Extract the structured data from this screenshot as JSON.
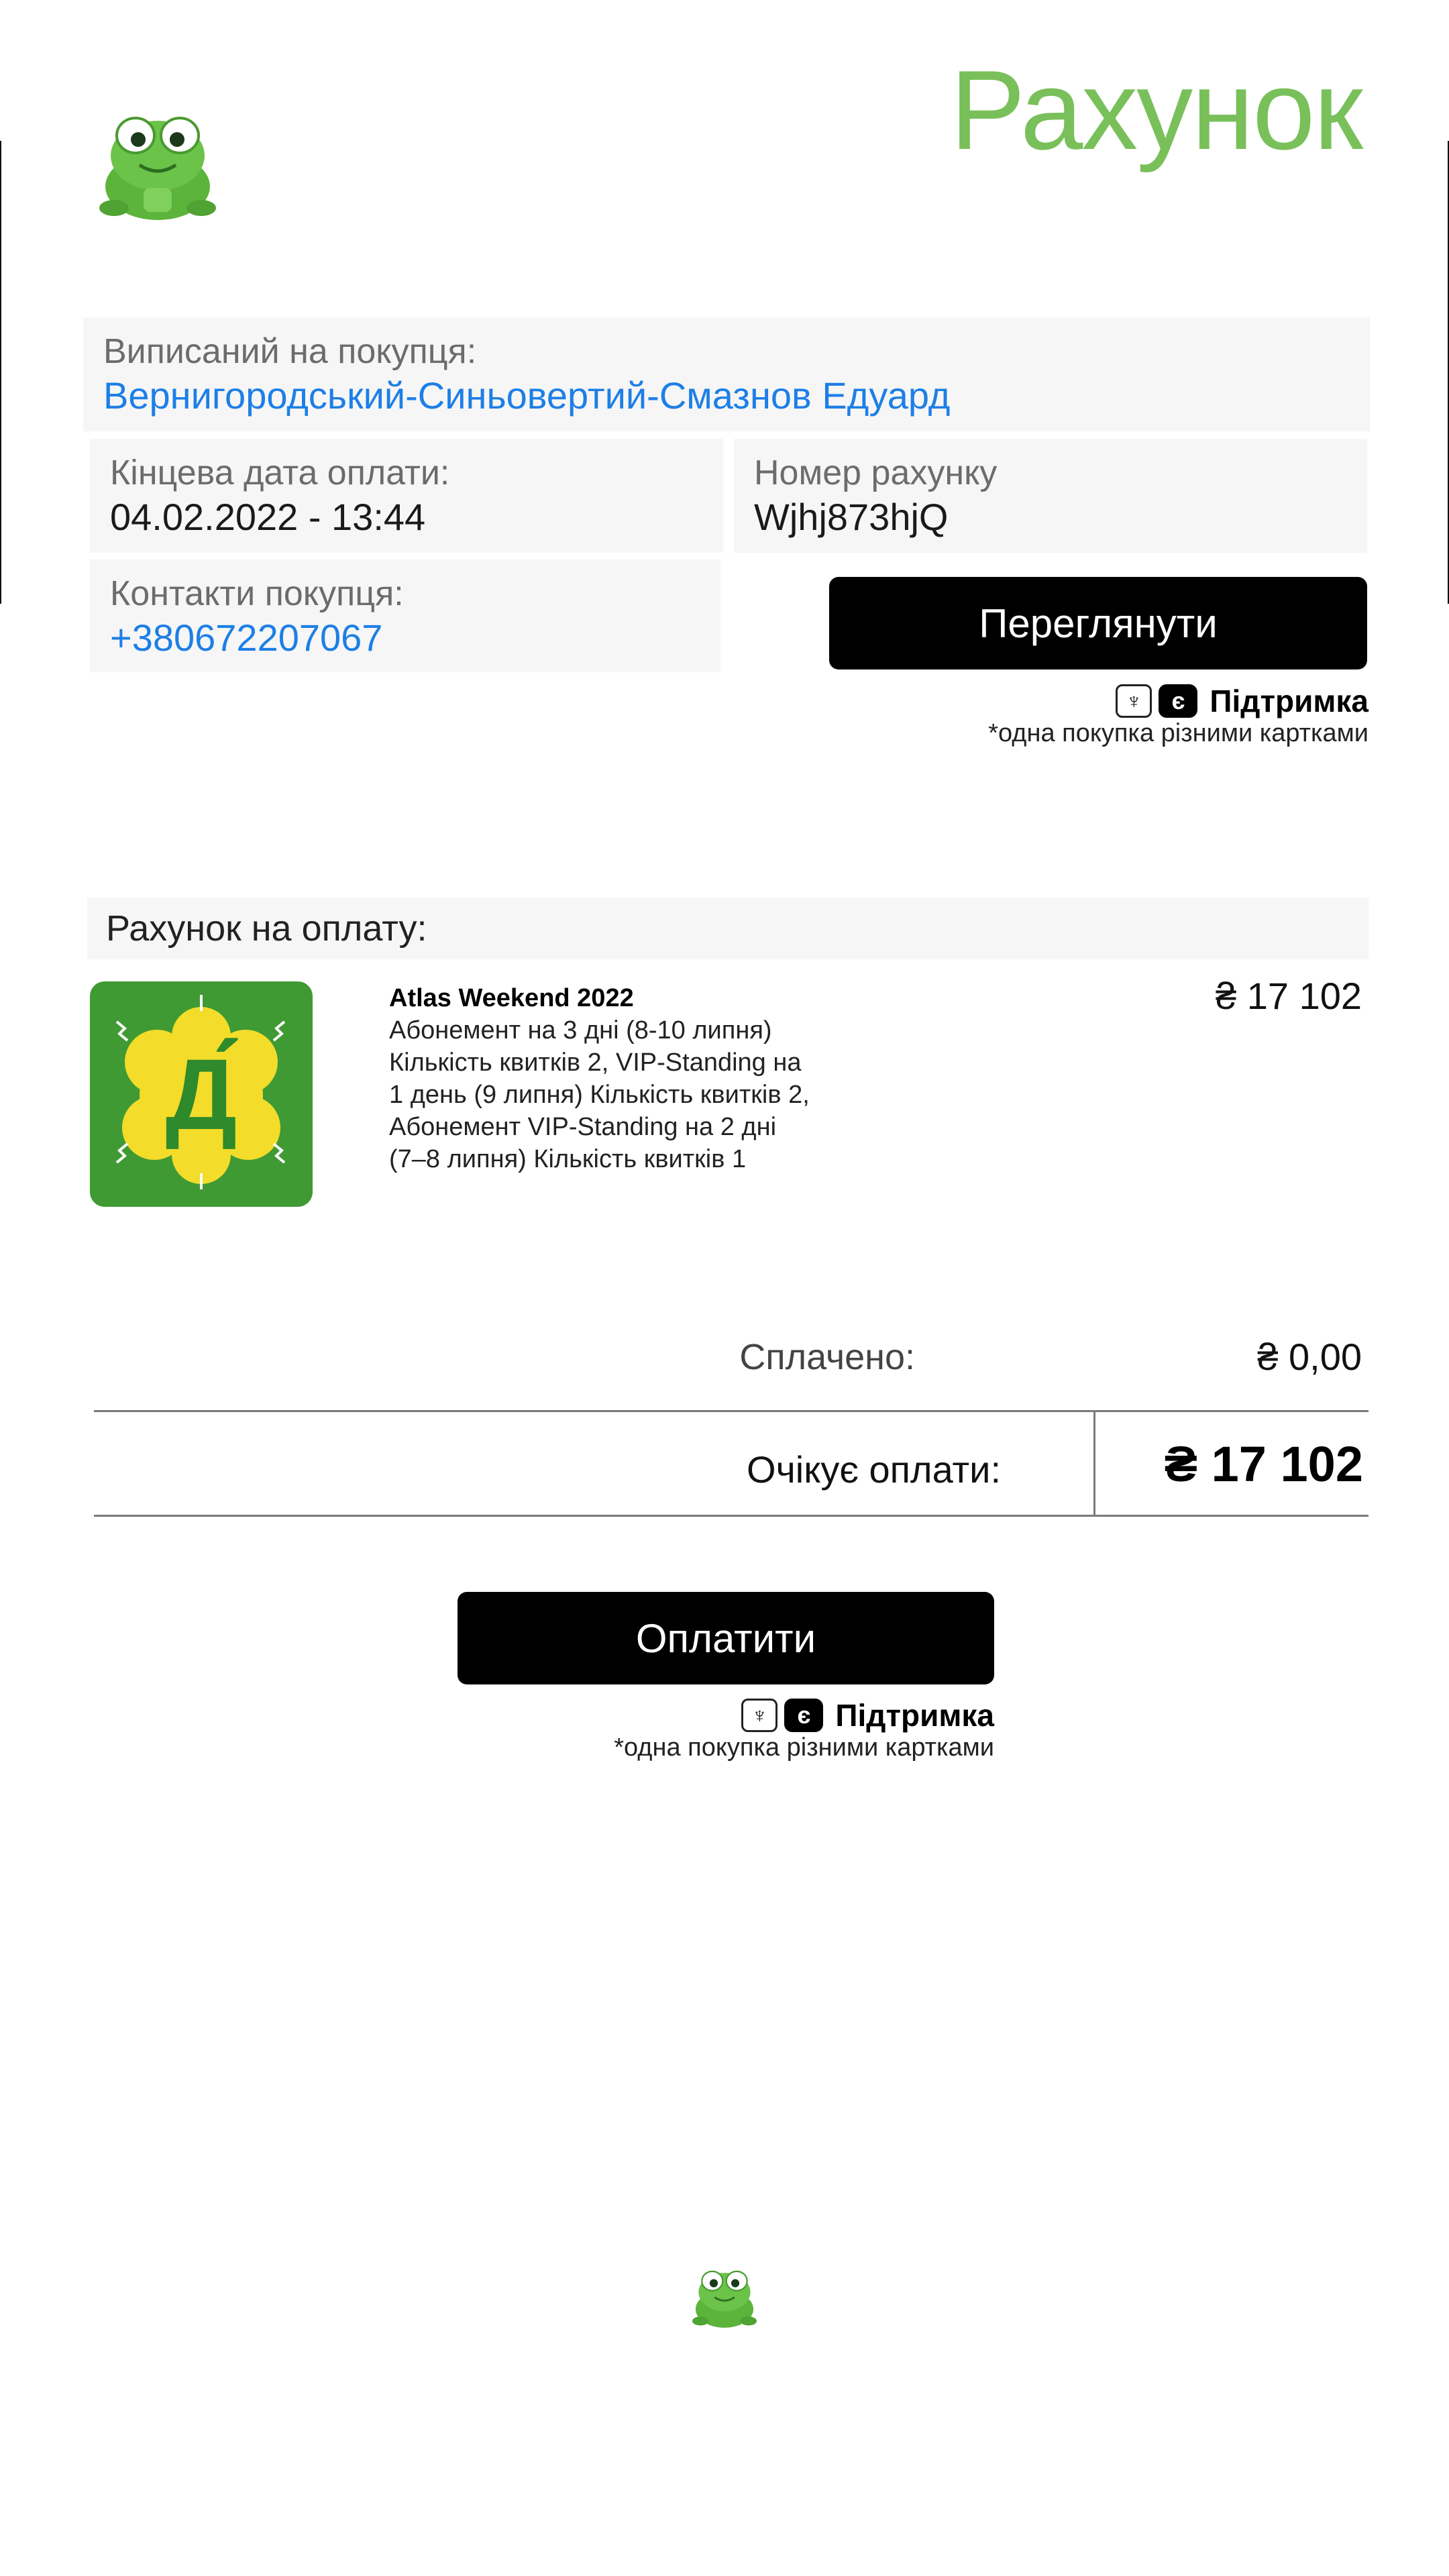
{
  "header": {
    "title": "Рахунок",
    "logo_icon": "frog-mascot-icon"
  },
  "buyer": {
    "issued_label": "Виписаний на покупця:",
    "issued_value": "Вернигородський-Синьовертий-Смазнов Едуард",
    "due_label": "Кінцева дата оплати:",
    "due_value": "04.02.2022 - 13:44",
    "invoice_label": "Номер рахунку",
    "invoice_value": "Wjhj873hjQ",
    "contacts_label": "Контакти покупця:",
    "contacts_value": "+380672207067"
  },
  "view_button": "Переглянути",
  "support": {
    "label": "Підтримка",
    "note": "*одна покупка різними картками",
    "ua_icon": "trident-icon",
    "e_icon": "e-letter-icon",
    "e_glyph": "є",
    "ua_glyph": "♆"
  },
  "invoice_section": {
    "title": "Рахунок на оплату:"
  },
  "item": {
    "title": "Atlas Weekend 2022",
    "description": "Абонемент на 3 дні (8-10 липня) Кількість квитків 2, VIP-Standing на 1 день (9 липня) Кількість квитків 2, Абонемент VIP-Standing на 2 дні (7–8 липня) Кількість квитків 1",
    "price": "₴ 17 102",
    "image_icon": "atlas-weekend-icon",
    "image_letter": "Д́"
  },
  "summary": {
    "paid_label": "Сплачено:",
    "paid_value": "₴ 0,00",
    "due_label": "Очікує оплати:",
    "due_value": "₴ 17 102"
  },
  "pay_button": "Оплатити",
  "colors": {
    "accent": "#79c05a",
    "link": "#1d7fe6",
    "button": "#000000",
    "card_bg": "#f6f6f6"
  }
}
